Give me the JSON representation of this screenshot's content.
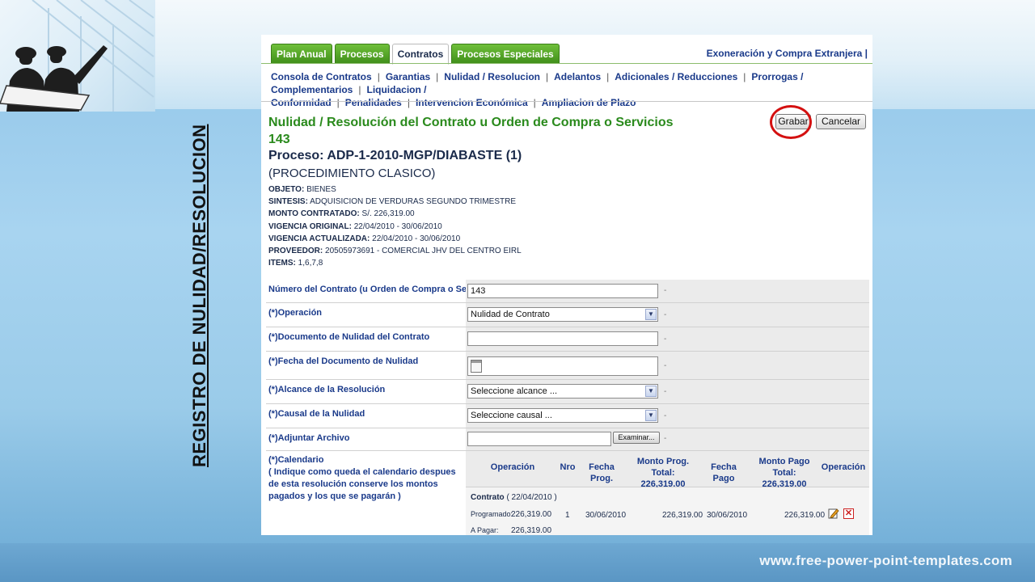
{
  "slide": {
    "vertical_title": "REGISTRO DE NULIDAD/RESOLUCION",
    "watermark": "www.free-power-point-templates.com"
  },
  "tabs": [
    {
      "label": "Plan Anual",
      "active": false
    },
    {
      "label": "Procesos",
      "active": false
    },
    {
      "label": "Contratos",
      "active": true
    },
    {
      "label": "Procesos Especiales",
      "active": false
    }
  ],
  "top_right_link": "Exoneración y Compra Extranjera |",
  "subnav": [
    "Consola de Contratos",
    "Garantias",
    "Nulidad / Resolucion",
    "Adelantos",
    "Adicionales / Reducciones",
    "Prorrogas / Complementarios",
    "Liquidacion /",
    "Conformidad",
    "Penalidades",
    "Intervencion Económica",
    "Ampliacion de Plazo"
  ],
  "header": {
    "title": "Nulidad / Resolución del Contrato u Orden de Compra o Servicios",
    "contract_no": "143",
    "proceso": "Proceso: ADP-1-2010-MGP/DIABASTE (1)",
    "procedimiento": "(PROCEDIMIENTO CLASICO)"
  },
  "info": {
    "objeto_label": "OBJETO:",
    "objeto": "BIENES",
    "sintesis_label": "SINTESIS:",
    "sintesis": "ADQUISICION DE VERDURAS SEGUNDO TRIMESTRE",
    "monto_label": "MONTO CONTRATADO:",
    "monto": "S/.  226,319.00",
    "vig_orig_label": "VIGENCIA ORIGINAL:",
    "vig_orig": "22/04/2010 - 30/06/2010",
    "vig_act_label": "VIGENCIA ACTUALIZADA:",
    "vig_act": "22/04/2010 - 30/06/2010",
    "proveedor_label": "PROVEEDOR:",
    "proveedor": "20505973691 - COMERCIAL JHV DEL CENTRO EIRL",
    "items_label": "ITEMS:",
    "items": "1,6,7,8"
  },
  "buttons": {
    "grabar": "Grabar",
    "cancelar": "Cancelar"
  },
  "form": {
    "numero_label": "Número del Contrato (u Orden de Compra o Servicio)",
    "numero_value": "143",
    "operacion_label": "(*)Operación",
    "operacion_value": "Nulidad de Contrato",
    "documento_label": "(*)Documento de Nulidad del Contrato",
    "documento_value": "",
    "fecha_label": "(*)Fecha del Documento de Nulidad",
    "fecha_value": "",
    "alcance_label": "(*)Alcance de la Resolución",
    "alcance_value": "Seleccione alcance ...",
    "causal_label": "(*)Causal de la Nulidad",
    "causal_value": "Seleccione causal ...",
    "adjuntar_label": "(*)Adjuntar Archivo",
    "examinar_label": "Examinar...",
    "dot": "-"
  },
  "calendar": {
    "label": "(*)Calendario",
    "note": "( Indique como queda el calendario despues de esta resolución conserve los montos pagados y los que se pagarán )",
    "headers": {
      "operacion": "Operación",
      "nro": "Nro",
      "fecha_prog": "Fecha Prog.",
      "monto_prog": "Monto Prog.",
      "monto_prog_total": "Total: 226,319.00",
      "fecha_pago": "Fecha Pago",
      "monto_pago": "Monto Pago",
      "monto_pago_total": "Total: 226,319.00",
      "accion": "Operación"
    },
    "row": {
      "contrato_label": "Contrato",
      "contrato_date": "( 22/04/2010 )",
      "programado_label": "Programado:",
      "programado_value": "226,319.00",
      "a_pagar_label": "A Pagar:",
      "a_pagar_value": "226,319.00",
      "nro": "1",
      "fecha_prog": "30/06/2010",
      "monto_prog": "226,319.00",
      "fecha_pago": "30/06/2010",
      "monto_pago": "226,319.00"
    }
  }
}
